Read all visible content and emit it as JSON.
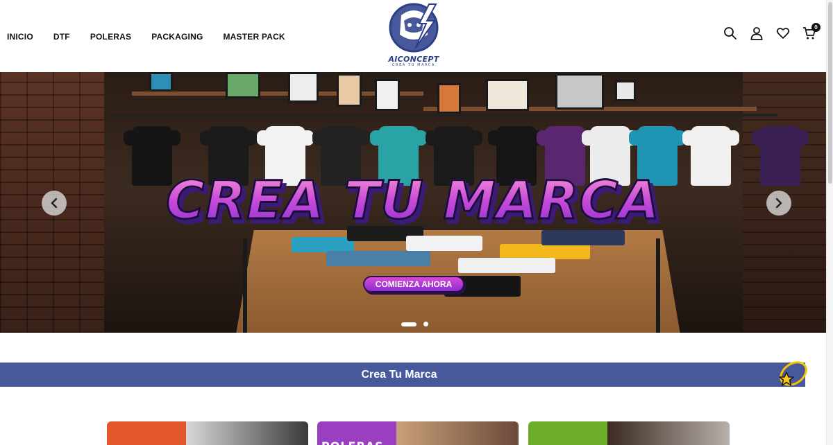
{
  "nav": {
    "items": [
      "INICIO",
      "DTF",
      "POLERAS",
      "PACKAGING",
      "MASTER PACK"
    ]
  },
  "logo": {
    "name": "AICONCEPT",
    "tagline": "CREA TU MARCA",
    "color": "#48599b"
  },
  "header_icons": {
    "search": "search-icon",
    "account": "user-icon",
    "wishlist": "heart-icon",
    "cart": "cart-icon",
    "cart_count": "0"
  },
  "hero": {
    "headline": "CREA TU MARCA",
    "cta_label": "COMIENZA AHORA",
    "slides": 2,
    "active_slide": 1,
    "prev": "chevron-left-icon",
    "next": "chevron-right-icon"
  },
  "section": {
    "title": "Crea Tu Marca",
    "accent_color": "#48599b"
  },
  "cards": [
    {
      "label": "",
      "color": "#e2572b"
    },
    {
      "label": "POLERAS",
      "color": "#9a3fbf"
    },
    {
      "label": "",
      "color": "#6cae2a"
    }
  ]
}
